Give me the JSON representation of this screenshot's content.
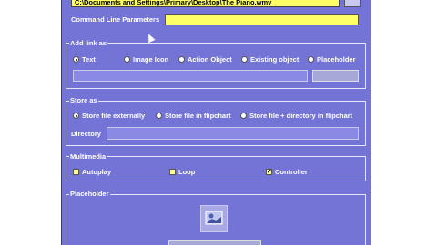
{
  "file": {
    "path": "C:\\Documents and Settings\\Primary\\Desktop\\The Piano.wmv"
  },
  "command_line": {
    "label": "Command Line Parameters",
    "value": ""
  },
  "add_link": {
    "title": "Add link as",
    "options": [
      "Text",
      "Image Icon",
      "Action Object",
      "Existing object",
      "Placeholder"
    ],
    "selected": "Text"
  },
  "store": {
    "title": "Store as",
    "options": [
      "Store file externally",
      "Store file in flipchart",
      "Store file + directory in flipchart"
    ],
    "selected": "Store file externally",
    "directory_label": "Directory"
  },
  "multimedia": {
    "title": "Multimedia",
    "options": [
      {
        "label": "Autoplay",
        "checked": false
      },
      {
        "label": "Loop",
        "checked": false
      },
      {
        "label": "Controller",
        "checked": true
      }
    ]
  },
  "placeholder": {
    "title": "Placeholder"
  },
  "colors": {
    "panel": "#7474d6",
    "input": "#ffff66",
    "text": "#ffffff"
  }
}
